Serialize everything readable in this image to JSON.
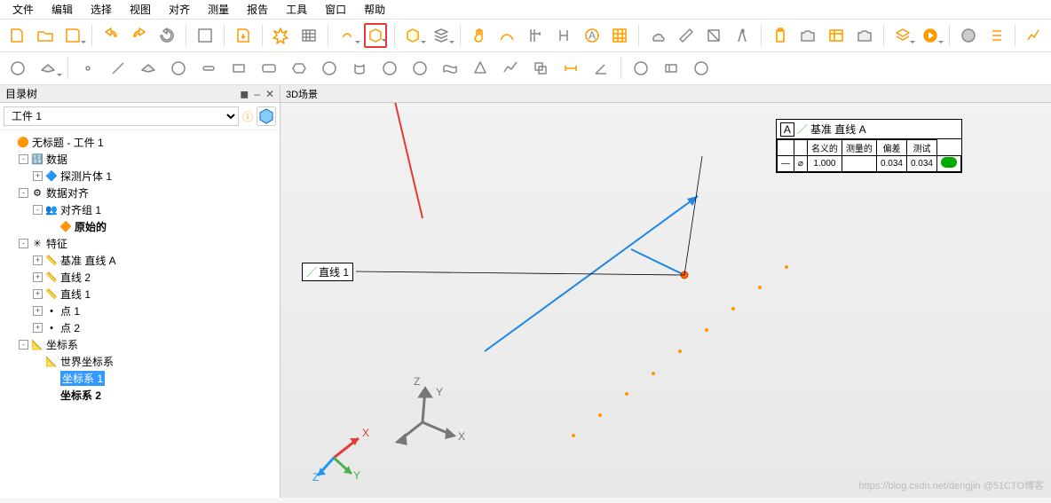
{
  "menu": {
    "items": [
      "文件",
      "编辑",
      "选择",
      "视图",
      "对齐",
      "测量",
      "报告",
      "工具",
      "窗口",
      "帮助"
    ]
  },
  "toolbar1": {
    "buttons": [
      {
        "n": "new-icon"
      },
      {
        "n": "open-icon"
      },
      {
        "n": "save-icon",
        "dd": true
      },
      {
        "sep": true
      },
      {
        "n": "undo-icon"
      },
      {
        "n": "redo-icon"
      },
      {
        "n": "refresh-icon"
      },
      {
        "sep": true
      },
      {
        "n": "settings-icon"
      },
      {
        "sep": true
      },
      {
        "n": "import-icon"
      },
      {
        "sep": true
      },
      {
        "n": "burst-icon"
      },
      {
        "n": "matrix-icon"
      },
      {
        "sep": true
      },
      {
        "n": "cloud-icon",
        "dd": true
      },
      {
        "n": "cube-icon",
        "dd": true,
        "hl": true
      },
      {
        "sep": true
      },
      {
        "n": "box-icon",
        "dd": true
      },
      {
        "n": "stack-icon",
        "dd": true
      },
      {
        "sep": true
      },
      {
        "n": "hand-icon"
      },
      {
        "n": "path-icon"
      },
      {
        "n": "caliper-icon"
      },
      {
        "n": "bracket-icon"
      },
      {
        "n": "a-circle-icon"
      },
      {
        "n": "grid-icon"
      },
      {
        "sep": true
      },
      {
        "n": "cloud2-icon"
      },
      {
        "n": "ruler-icon"
      },
      {
        "n": "scale-icon"
      },
      {
        "n": "compass-icon"
      },
      {
        "sep": true
      },
      {
        "n": "clipboard-icon"
      },
      {
        "n": "camera-plus-icon"
      },
      {
        "n": "table-icon"
      },
      {
        "n": "camera-icon"
      },
      {
        "sep": true
      },
      {
        "n": "layers-icon",
        "dd": true
      },
      {
        "n": "play-icon",
        "dd": true
      },
      {
        "sep": true
      },
      {
        "n": "stop-icon"
      },
      {
        "n": "list-icon"
      },
      {
        "sep": true
      },
      {
        "n": "chart-icon"
      }
    ]
  },
  "toolbar2": {
    "buttons": [
      {
        "n": "sphere-pts-icon"
      },
      {
        "n": "plane-pts-icon",
        "dd": true
      },
      {
        "sep": true
      },
      {
        "n": "point-icon"
      },
      {
        "n": "line-icon"
      },
      {
        "n": "plane-icon"
      },
      {
        "n": "circle-icon"
      },
      {
        "n": "slot-icon"
      },
      {
        "n": "rect-icon"
      },
      {
        "n": "round-rect-icon"
      },
      {
        "n": "hex-icon"
      },
      {
        "n": "ellipse-icon"
      },
      {
        "n": "cylinder-icon"
      },
      {
        "n": "sphere-icon"
      },
      {
        "n": "torus-icon"
      },
      {
        "n": "surface-icon"
      },
      {
        "n": "cone-icon"
      },
      {
        "n": "polyline-icon"
      },
      {
        "n": "offset-icon"
      },
      {
        "n": "dim-icon"
      },
      {
        "n": "angle-icon"
      },
      {
        "sep": true
      },
      {
        "n": "target-icon"
      },
      {
        "n": "gd-icon"
      },
      {
        "n": "gear-sm-icon"
      }
    ]
  },
  "sidebar": {
    "title": "目录树",
    "combo": "工件 1",
    "tree": [
      {
        "d": 0,
        "tw": "",
        "ic": "🟠",
        "t": "无标题 - 工件 1"
      },
      {
        "d": 1,
        "tw": "-",
        "ic": "🔢",
        "t": "数据"
      },
      {
        "d": 2,
        "tw": "+",
        "ic": "🔷",
        "t": "探测片体 1"
      },
      {
        "d": 1,
        "tw": "-",
        "ic": "⚙",
        "t": "数据对齐"
      },
      {
        "d": 2,
        "tw": "-",
        "ic": "👥",
        "t": "对齐组 1"
      },
      {
        "d": 3,
        "tw": "",
        "ic": "🔶",
        "t": "原始的",
        "b": true
      },
      {
        "d": 1,
        "tw": "-",
        "ic": "✳",
        "t": "特征"
      },
      {
        "d": 2,
        "tw": "+",
        "ic": "📏",
        "t": "基准 直线 A"
      },
      {
        "d": 2,
        "tw": "+",
        "ic": "📏",
        "t": "直线 2"
      },
      {
        "d": 2,
        "tw": "+",
        "ic": "📏",
        "t": "直线 1"
      },
      {
        "d": 2,
        "tw": "+",
        "ic": "•",
        "t": "点 1"
      },
      {
        "d": 2,
        "tw": "+",
        "ic": "•",
        "t": "点 2"
      },
      {
        "d": 1,
        "tw": "-",
        "ic": "📐",
        "t": "坐标系"
      },
      {
        "d": 2,
        "tw": "",
        "ic": "📐",
        "t": "世界坐标系"
      },
      {
        "d": 2,
        "tw": "",
        "ic": "",
        "t": "坐标系 1",
        "sel": true
      },
      {
        "d": 2,
        "tw": "",
        "ic": "",
        "t": "坐标系 2",
        "b": true
      }
    ]
  },
  "viewport": {
    "title": "3D场景",
    "label1": {
      "text": "直线 1"
    },
    "label2": {
      "title": "基准 直线 A",
      "badge": "A",
      "cols": [
        "名义的",
        "测量的",
        "偏差",
        "测试"
      ],
      "sym": "⌀",
      "nominal": "1.000",
      "measured": "",
      "dev": "0.034",
      "tol": "0.034"
    },
    "axes": {
      "x": "X",
      "y": "Y",
      "z": "Z"
    }
  },
  "watermark": "https://blog.csdn.net/dengjin @51CTO博客"
}
